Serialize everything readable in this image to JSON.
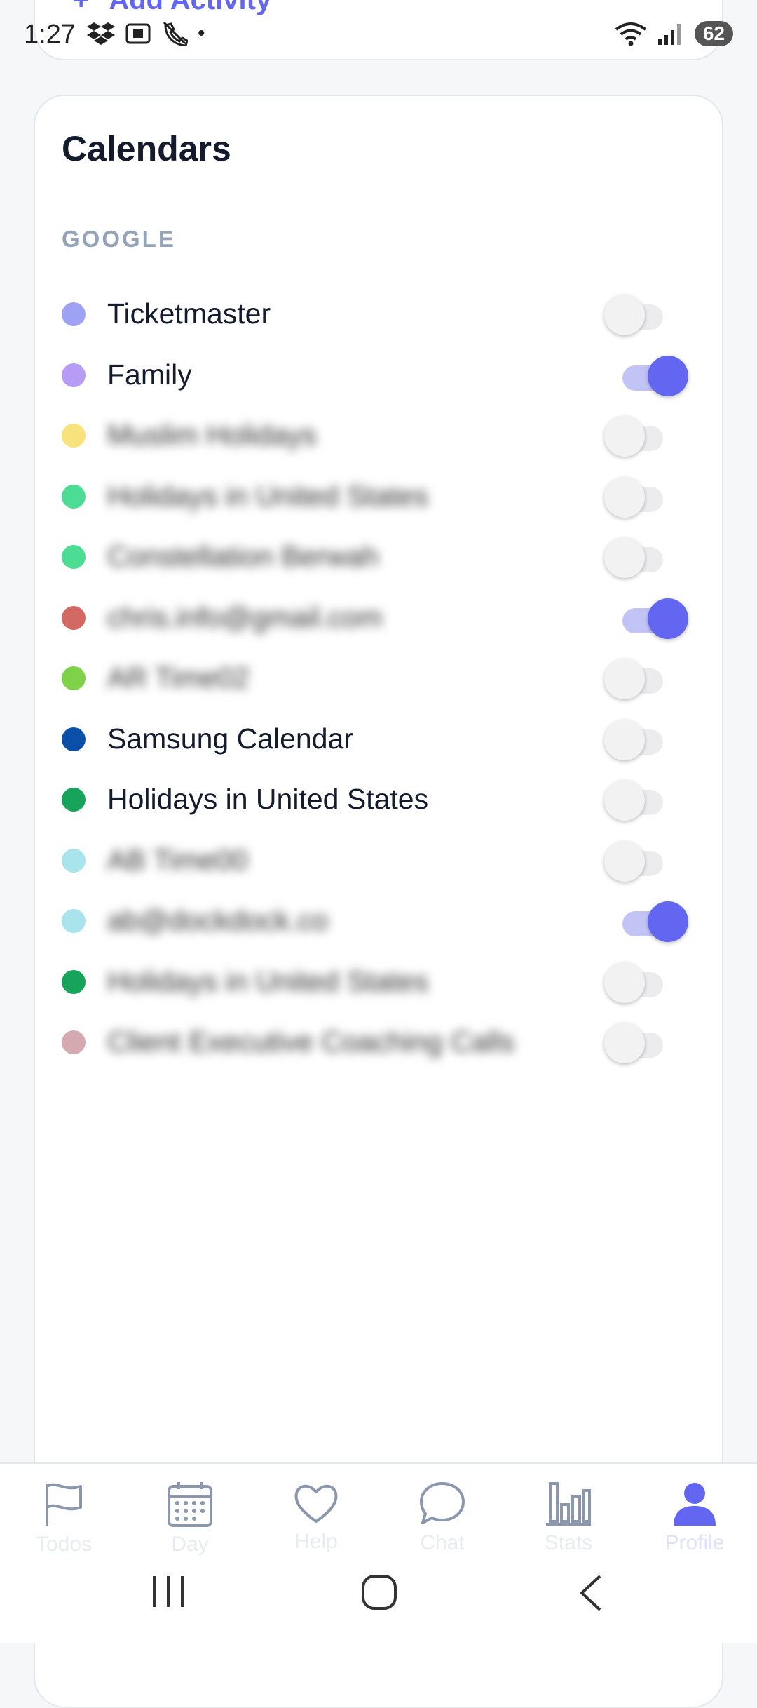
{
  "status_bar": {
    "time": "1:27",
    "battery": "62"
  },
  "top_card": {
    "add_activity_label": "Add Activity"
  },
  "calendars": {
    "title": "Calendars",
    "section": "GOOGLE",
    "items": [
      {
        "label": "Ticketmaster",
        "color": "#9fa1f5",
        "on": false,
        "blurred": false
      },
      {
        "label": "Family",
        "color": "#b79cf6",
        "on": true,
        "blurred": false
      },
      {
        "label": "Muslim Holidays",
        "color": "#f8e27c",
        "on": false,
        "blurred": true
      },
      {
        "label": "Holidays in United States",
        "color": "#4ddc93",
        "on": false,
        "blurred": true
      },
      {
        "label": "Constellation Berwah",
        "color": "#4ddc93",
        "on": false,
        "blurred": true
      },
      {
        "label": "chris.info@gmail.com",
        "color": "#d26a63",
        "on": true,
        "blurred": true
      },
      {
        "label": "AR Time02",
        "color": "#7fd14a",
        "on": false,
        "blurred": true
      },
      {
        "label": "Samsung Calendar",
        "color": "#0a4fa8",
        "on": false,
        "blurred": false
      },
      {
        "label": "Holidays in United States",
        "color": "#18a35a",
        "on": false,
        "blurred": false
      },
      {
        "label": "AB Time00",
        "color": "#a9e4ec",
        "on": false,
        "blurred": true
      },
      {
        "label": "ab@dockdock.co",
        "color": "#a9e4ec",
        "on": true,
        "blurred": true
      },
      {
        "label": "Holidays in United States",
        "color": "#18a35a",
        "on": false,
        "blurred": true
      },
      {
        "label": "Client Executive Coaching Calls",
        "color": "#d5a9b0",
        "on": false,
        "blurred": true
      }
    ]
  },
  "bottom_nav": {
    "items": [
      {
        "label": "Todos",
        "icon": "flag-icon"
      },
      {
        "label": "Day",
        "icon": "calendar-icon"
      },
      {
        "label": "Help",
        "icon": "heart-icon"
      },
      {
        "label": "Chat",
        "icon": "chat-bubble-icon"
      },
      {
        "label": "Stats",
        "icon": "bar-chart-icon"
      },
      {
        "label": "Profile",
        "icon": "person-icon"
      }
    ],
    "active": "Profile"
  }
}
